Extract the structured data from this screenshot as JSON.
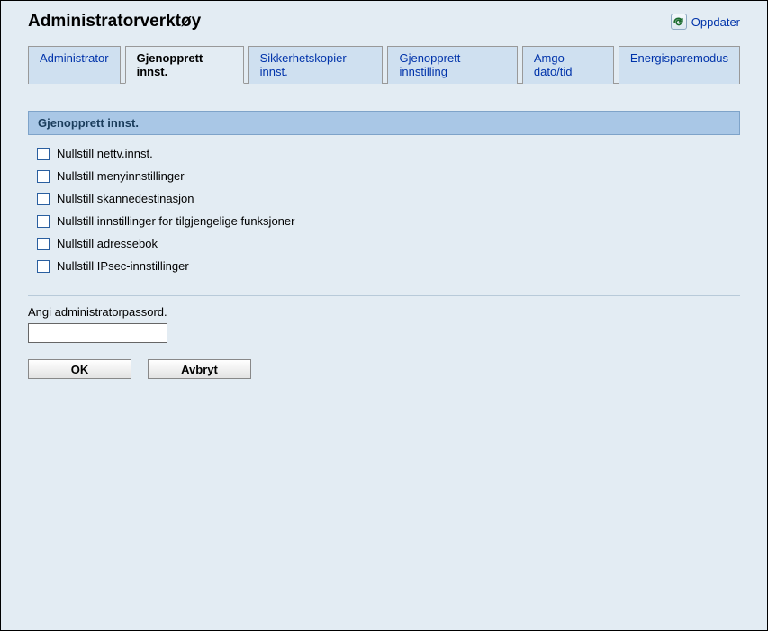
{
  "page_title": "Administratorverktøy",
  "refresh_label": "Oppdater",
  "tabs": [
    {
      "label": "Administrator",
      "active": false
    },
    {
      "label": "Gjenopprett innst.",
      "active": true
    },
    {
      "label": "Sikkerhetskopier innst.",
      "active": false
    },
    {
      "label": "Gjenopprett innstilling",
      "active": false
    },
    {
      "label": "Amgo dato/tid",
      "active": false
    },
    {
      "label": "Energisparemodus",
      "active": false
    }
  ],
  "section_header": "Gjenopprett innst.",
  "checkboxes": [
    {
      "label": "Nullstill nettv.innst."
    },
    {
      "label": "Nullstill menyinnstillinger"
    },
    {
      "label": "Nullstill skannedestinasjon"
    },
    {
      "label": "Nullstill innstillinger for tilgjengelige funksjoner"
    },
    {
      "label": "Nullstill adressebok"
    },
    {
      "label": "Nullstill IPsec-innstillinger"
    }
  ],
  "password_prompt": "Angi administratorpassord.",
  "buttons": {
    "ok": "OK",
    "cancel": "Avbryt"
  }
}
